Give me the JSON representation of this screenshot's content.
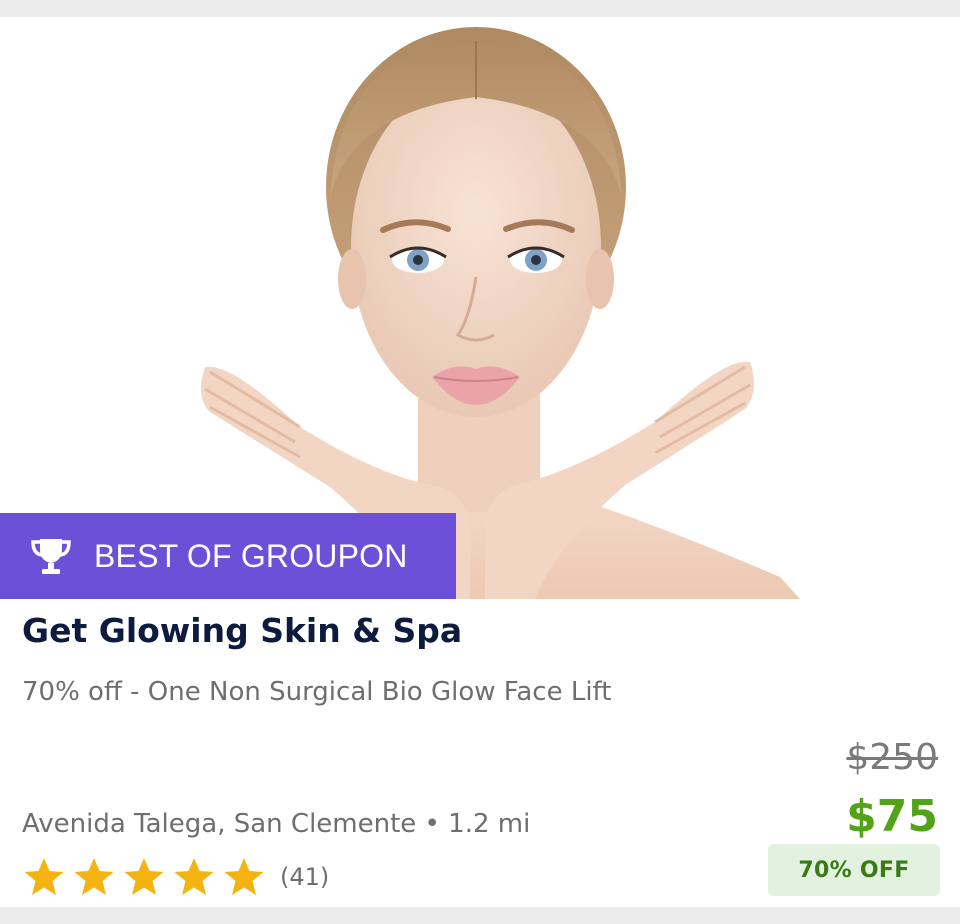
{
  "deal": {
    "badge": {
      "icon": "trophy-icon",
      "label": "BEST OF GROUPON",
      "color": "#6c50d8"
    },
    "image": {
      "icon": "spa-model-photo"
    },
    "title": "Get Glowing Skin & Spa",
    "subtitle": "70% off - One Non Surgical Bio Glow Face Lift",
    "location": "Avenida Talega, San Clemente • 1.2 mi",
    "rating": {
      "stars": 5,
      "max_stars": 5,
      "count_label": "(41)",
      "star_color": "#f5b312"
    },
    "price": {
      "original": "$250",
      "current": "$75",
      "current_color": "#53a318",
      "discount_label": "70% OFF"
    }
  }
}
